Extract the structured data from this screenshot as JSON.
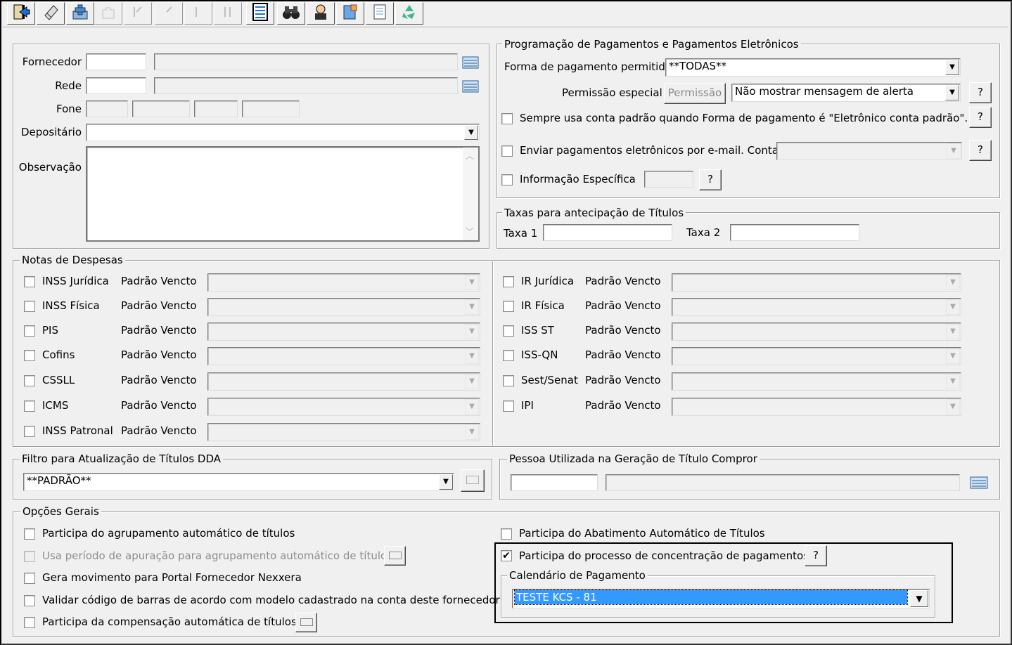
{
  "toolbar": {
    "items": [
      {
        "name": "exit-door-icon"
      },
      {
        "name": "eraser-icon"
      },
      {
        "name": "add-record-icon"
      },
      {
        "name": "puzzle-icon"
      },
      {
        "name": "first-record-icon"
      },
      {
        "name": "previous-record-icon"
      },
      {
        "name": "next-record-icon"
      },
      {
        "name": "last-record-icon"
      },
      {
        "name": "list-icon"
      },
      {
        "name": "binoculars-icon"
      },
      {
        "name": "user-icon"
      },
      {
        "name": "report-icon"
      },
      {
        "name": "document-icon"
      },
      {
        "name": "recycle-icon"
      }
    ]
  },
  "supplier": {
    "fornecedor_label": "Fornecedor",
    "rede_label": "Rede",
    "fone_label": "Fone",
    "depositario_label": "Depositário",
    "observacao_label": "Observação"
  },
  "payments": {
    "title": "Programação de Pagamentos e Pagamentos Eletrônicos",
    "forma_label": "Forma de pagamento permitida",
    "forma_value": "**TODAS**",
    "permissao_label": "Permissão especial",
    "permissao_button": "Permissão",
    "permissao_value": "Não mostrar mensagem de alerta",
    "help": "?",
    "sempre_label": "Sempre usa conta padrão quando Forma de pagamento é \"Eletrônico conta padrão\".",
    "enviar_label": "Enviar pagamentos eletrônicos por e-mail. Contato:",
    "info_label": "Informação Específica"
  },
  "taxas": {
    "title": "Taxas para antecipação de Títulos",
    "taxa1_label": "Taxa 1",
    "taxa2_label": "Taxa 2"
  },
  "notas": {
    "title": "Notas de Despesas",
    "padrao_label": "Padrão Vencto",
    "left": [
      "INSS Jurídica",
      "INSS Física",
      "PIS",
      "Cofins",
      "CSSLL",
      "ICMS",
      "INSS Patronal"
    ],
    "right": [
      "IR Jurídica",
      "IR Física",
      "ISS ST",
      "ISS-QN",
      "Sest/Senat",
      "IPI"
    ]
  },
  "dda": {
    "title": "Filtro para Atualização de Títulos DDA",
    "value": "**PADRÃO**"
  },
  "pessoa": {
    "title": "Pessoa Utilizada na Geração de Título Compror"
  },
  "opcoes": {
    "title": "Opções Gerais",
    "left": [
      {
        "label": "Participa do agrupamento automático de títulos",
        "checked": false,
        "disabled": false
      },
      {
        "label": "Usa período de apuração para agrupamento automático de títulos",
        "checked": false,
        "disabled": true
      },
      {
        "label": "Gera movimento para Portal Fornecedor Nexxera",
        "checked": false,
        "disabled": false
      },
      {
        "label": "Validar código de barras de acordo com modelo cadastrado na conta deste fornecedor",
        "checked": false,
        "disabled": false
      },
      {
        "label": "Participa da compensação automática de títulos",
        "checked": false,
        "disabled": false
      }
    ],
    "abatimento_label": "Participa do Abatimento Automático de Títulos",
    "concentracao_label": "Participa do processo de concentração de pagamentos",
    "concentracao_checked": true,
    "calendario_title": "Calendário de Pagamento",
    "calendario_value": "TESTE KCS - 81"
  }
}
